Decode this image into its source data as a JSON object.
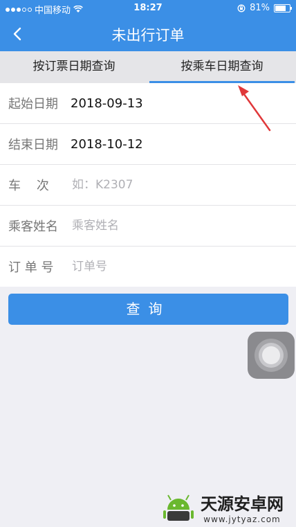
{
  "status_bar": {
    "carrier": "中国移动",
    "time": "18:27",
    "battery": "81%",
    "battery_level": 0.81
  },
  "nav": {
    "title": "未出行订单"
  },
  "tabs": [
    {
      "label": "按订票日期查询",
      "active": false
    },
    {
      "label": "按乘车日期查询",
      "active": true
    }
  ],
  "form": {
    "start_date": {
      "label": "起始日期",
      "value": "2018-09-13"
    },
    "end_date": {
      "label": "结束日期",
      "value": "2018-10-12"
    },
    "train": {
      "label": "车    次",
      "placeholder": "如：K2307"
    },
    "passenger": {
      "label": "乘客姓名",
      "placeholder": "乘客姓名"
    },
    "order": {
      "label": "订 单 号",
      "placeholder": "订单号"
    }
  },
  "query_button": "查询",
  "watermark": {
    "title": "天源安卓网",
    "url": "www.jytyaz.com"
  },
  "colors": {
    "accent": "#3b8fe6",
    "annotation_arrow": "#e0383a"
  }
}
